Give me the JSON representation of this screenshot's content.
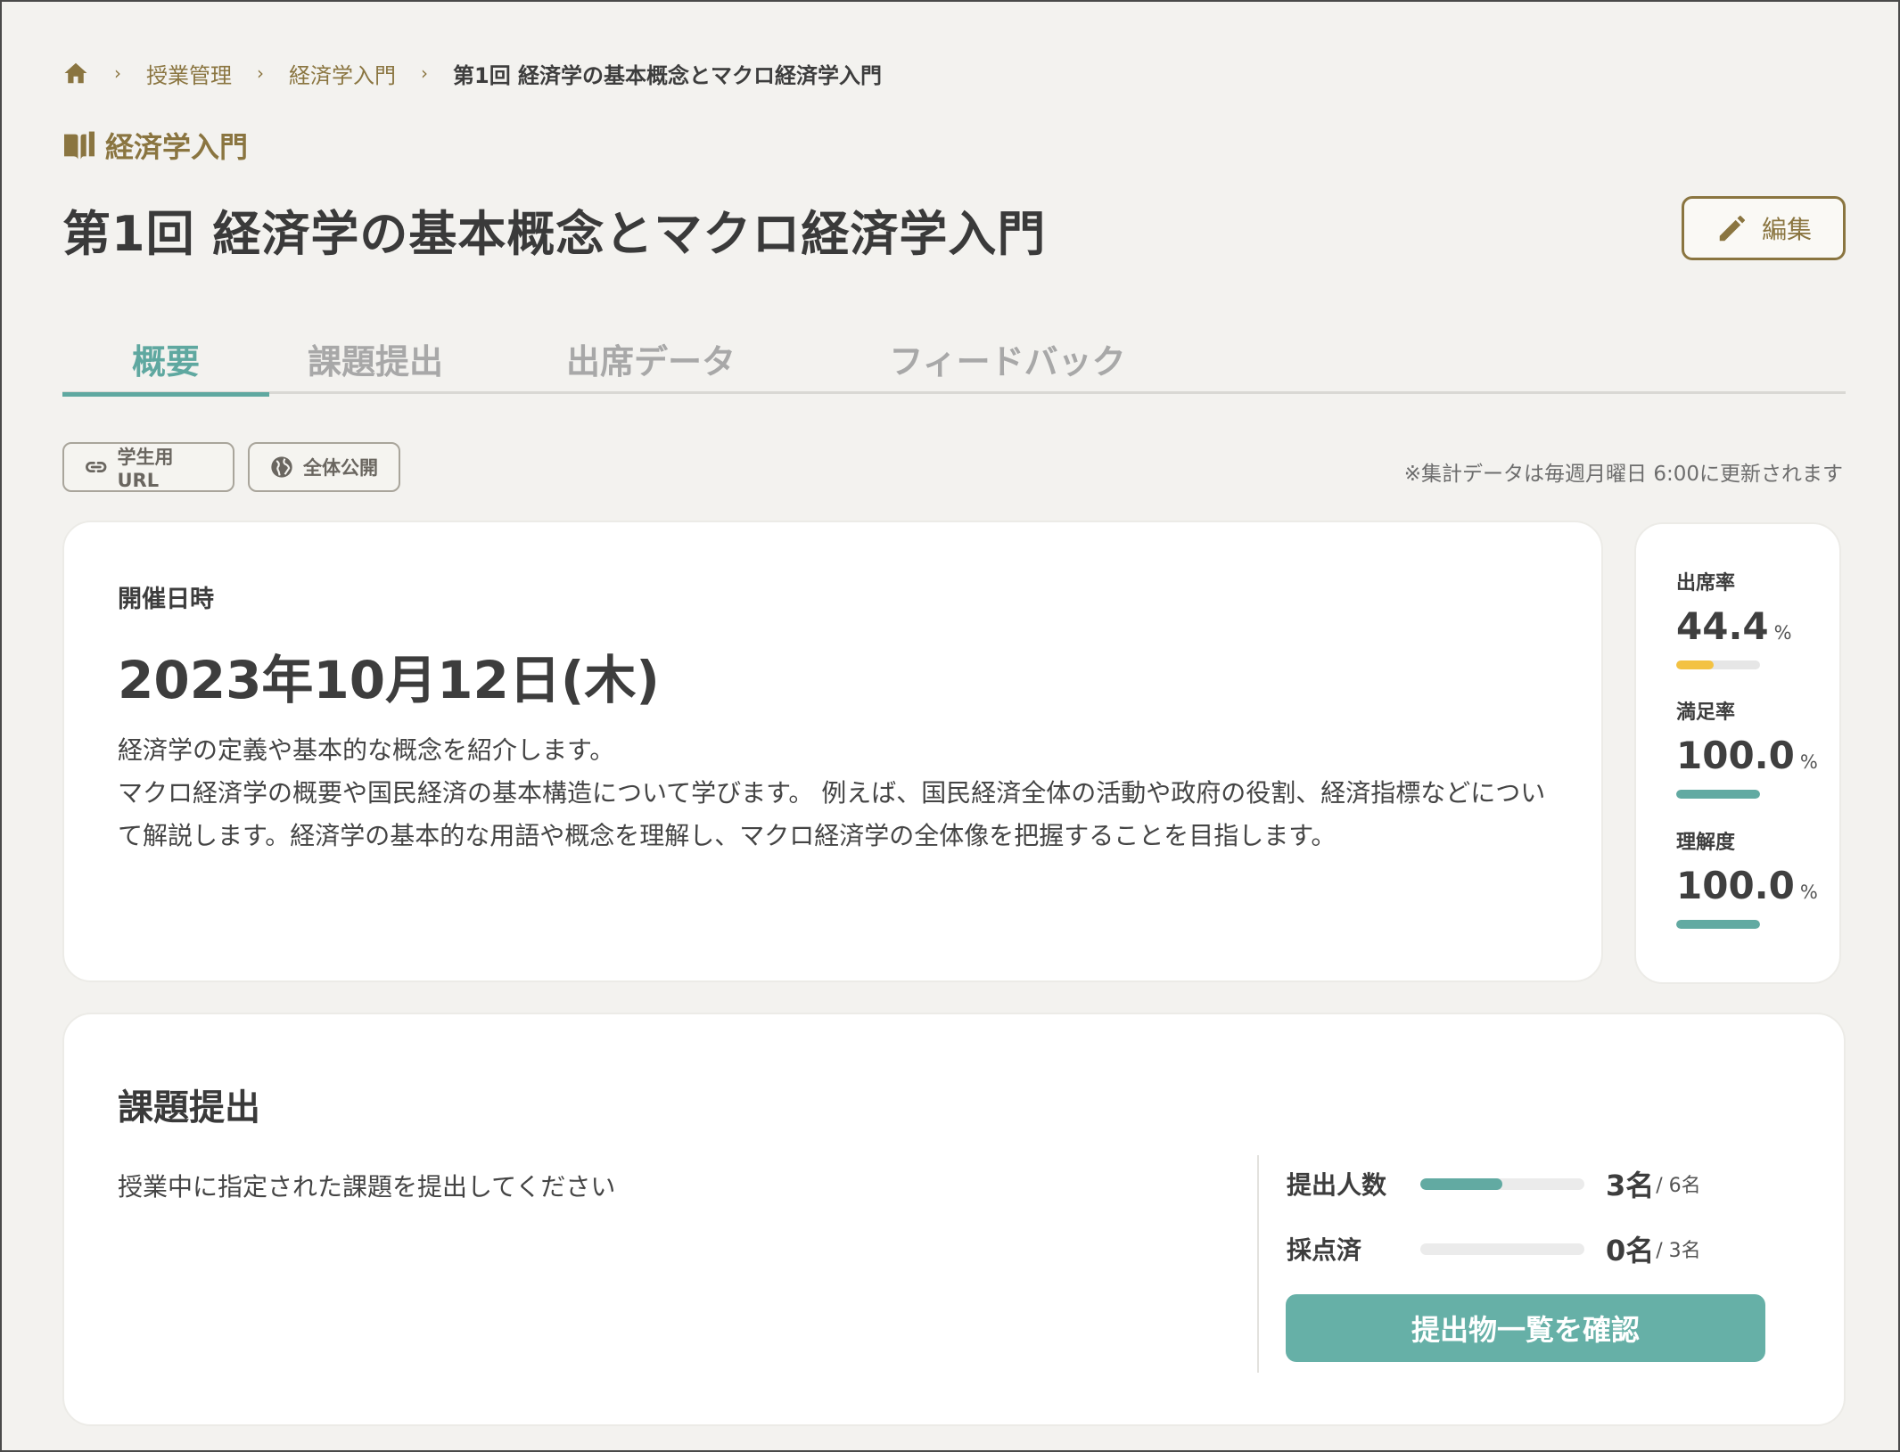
{
  "breadcrumb": {
    "home_icon": "home-icon",
    "items": [
      "授業管理",
      "経済学入門",
      "第1回 経済学の基本概念とマクロ経済学入門"
    ],
    "separator": "›"
  },
  "course": {
    "icon": "book-icon",
    "name": "経済学入門"
  },
  "page_title": "第1回 経済学の基本概念とマクロ経済学入門",
  "edit_button": {
    "icon": "pencil-icon",
    "label": "編集"
  },
  "tabs": [
    {
      "label": "概要",
      "active": true
    },
    {
      "label": "課題提出",
      "active": false
    },
    {
      "label": "出席データ",
      "active": false
    },
    {
      "label": "フィードバック",
      "active": false
    }
  ],
  "chips": {
    "student_url": {
      "icon": "link-icon",
      "label": "学生用URL"
    },
    "public": {
      "icon": "globe-icon",
      "label": "全体公開"
    }
  },
  "update_note": "※集計データは毎週月曜日 6:00に更新されます",
  "overview": {
    "date_label": "開催日時",
    "date": "2023年10月12日(木)",
    "description_lines": [
      "経済学の定義や基本的な概念を紹介します。",
      "マクロ経済学の概要や国民経済の基本構造について学びます。 例えば、国民経済全体の活動や政府の役割、経済指標などについ",
      "て解説します。経済学の基本的な用語や概念を理解し、マクロ経済学の全体像を把握することを目指します。"
    ]
  },
  "stats": [
    {
      "label": "出席率",
      "value": "44.4",
      "unit": "%",
      "fraction": 0.444,
      "color": "#f3c242"
    },
    {
      "label": "満足率",
      "value": "100.0",
      "unit": "%",
      "fraction": 1.0,
      "color": "#62aaa2"
    },
    {
      "label": "理解度",
      "value": "100.0",
      "unit": "%",
      "fraction": 1.0,
      "color": "#62aaa2"
    }
  ],
  "assignment": {
    "title": "課題提出",
    "description": "授業中に指定された課題を提出してください",
    "metrics": [
      {
        "label": "提出人数",
        "count": "3名",
        "total": "/ 6名",
        "fraction": 0.5
      },
      {
        "label": "採点済",
        "count": "0名",
        "total": "/ 3名",
        "fraction": 0.0
      }
    ],
    "button_label": "提出物一覧を確認"
  },
  "colors": {
    "accent": "#62aaa2",
    "brand": "#8a7540",
    "warning": "#f3c242"
  }
}
